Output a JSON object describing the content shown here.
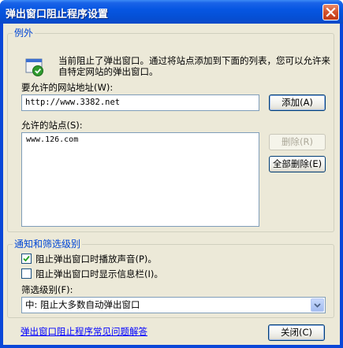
{
  "window": {
    "title": "弹出窗口阻止程序设置"
  },
  "exceptions": {
    "group_label": "例外",
    "info_text": "当前阻止了弹出窗口。通过将站点添加到下面的列表，您可以允许来自特定网站的弹出窗口。",
    "address_label": "要允许的网站地址(W):",
    "address_value": "http://www.3382.net",
    "add_button": "添加(A)",
    "allowed_label": "允许的站点(S):",
    "allowed_sites": [
      "www.126.com"
    ],
    "remove_button": "删除(R)",
    "remove_all_button": "全部删除(E)"
  },
  "notify": {
    "group_label": "通知和筛选级别",
    "play_sound": {
      "label": "阻止弹出窗口时播放声音(P)。",
      "checked": true
    },
    "show_infobar": {
      "label": "阻止弹出窗口时显示信息栏(I)。",
      "checked": false
    },
    "filter_label": "筛选级别(F):",
    "filter_value": "中: 阻止大多数自动弹出窗口"
  },
  "footer": {
    "faq_link": "弹出窗口阻止程序常见问题解答",
    "close_button": "关闭(C)"
  }
}
